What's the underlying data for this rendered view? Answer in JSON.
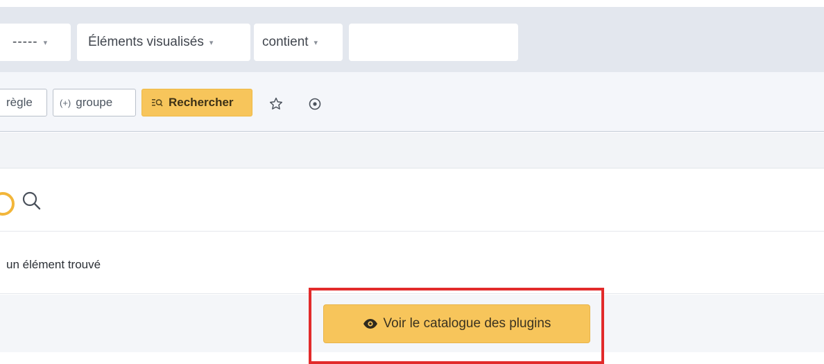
{
  "criteria": {
    "link_select": "-----",
    "field_select": "Éléments visualisés",
    "operator_select": "contient",
    "value": "",
    "caret": "▾"
  },
  "actions": {
    "rule_label": "règle",
    "group_symbol": "(+)",
    "group_label": "groupe",
    "search_label": "Rechercher"
  },
  "results": {
    "count_text": "un élément trouvé"
  },
  "catalog": {
    "button_label": "Voir le catalogue des plugins"
  },
  "colors": {
    "accent": "#f7c55b",
    "highlight": "#e22b2b"
  },
  "icons": [
    "star-icon",
    "reset-icon",
    "search-icon",
    "loading-spinner-icon",
    "eye-icon",
    "search-list-icon"
  ]
}
